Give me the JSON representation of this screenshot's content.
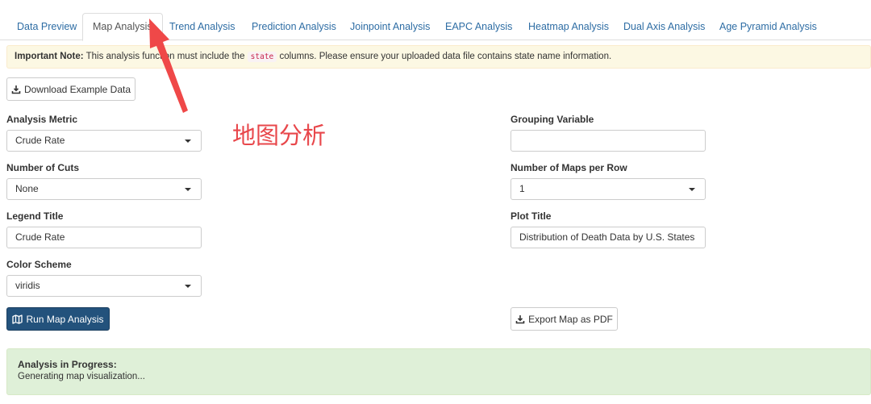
{
  "tabs": [
    {
      "label": "Data Preview",
      "active": false
    },
    {
      "label": "Map Analysis",
      "active": true
    },
    {
      "label": "Trend Analysis",
      "active": false
    },
    {
      "label": "Prediction Analysis",
      "active": false
    },
    {
      "label": "Joinpoint Analysis",
      "active": false
    },
    {
      "label": "EAPC Analysis",
      "active": false
    },
    {
      "label": "Heatmap Analysis",
      "active": false
    },
    {
      "label": "Dual Axis Analysis",
      "active": false
    },
    {
      "label": "Age Pyramid Analysis",
      "active": false
    }
  ],
  "note": {
    "strong": "Important Note:",
    "before": " This analysis function must include the ",
    "code": "state",
    "after": " columns. Please ensure your uploaded data file contains state name information."
  },
  "download_button": {
    "label": "Download Example Data",
    "icon": "download-icon"
  },
  "annotation": {
    "text": "地图分析",
    "color": "#e8474b"
  },
  "form": {
    "analysis_metric": {
      "label": "Analysis Metric",
      "value": "Crude Rate"
    },
    "number_of_cuts": {
      "label": "Number of Cuts",
      "value": "None"
    },
    "legend_title": {
      "label": "Legend Title",
      "value": "Crude Rate"
    },
    "color_scheme": {
      "label": "Color Scheme",
      "value": "viridis"
    },
    "grouping_variable": {
      "label": "Grouping Variable",
      "value": ""
    },
    "maps_per_row": {
      "label": "Number of Maps per Row",
      "value": "1"
    },
    "plot_title": {
      "label": "Plot Title",
      "value": "Distribution of Death Data by U.S. States"
    }
  },
  "run_button": {
    "label": "Run Map Analysis",
    "icon": "map-icon"
  },
  "export_button": {
    "label": "Export Map as PDF",
    "icon": "download-icon"
  },
  "status": {
    "title": "Analysis in Progress:",
    "message": "Generating map visualization..."
  },
  "colors": {
    "link": "#2e6da4",
    "primary": "#23527c",
    "warning_bg": "#fcf8e3",
    "success_bg": "#dff0d8",
    "annotation": "#e8474b"
  }
}
